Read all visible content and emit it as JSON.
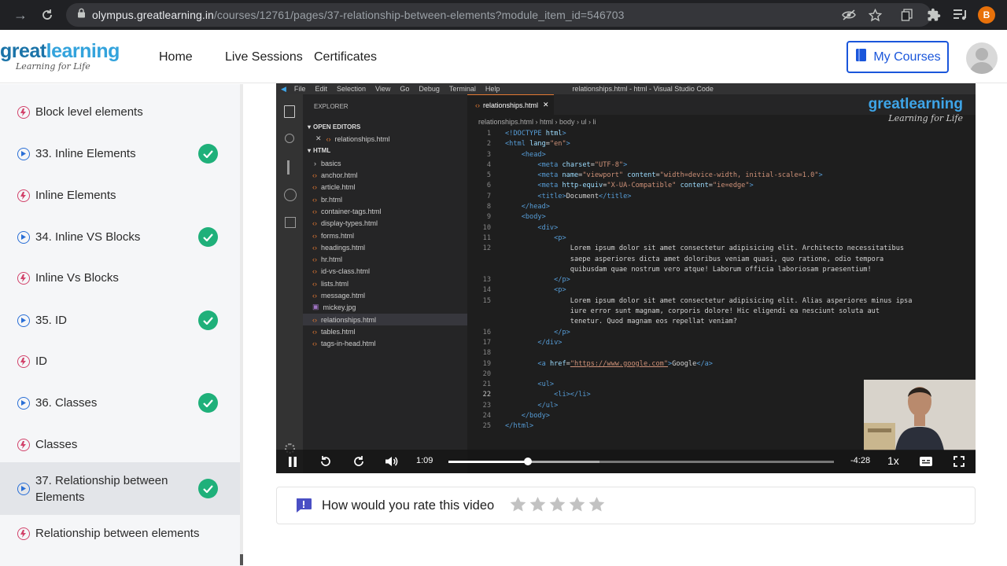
{
  "browser": {
    "url_host": "olympus.greatlearning.in",
    "url_path": "/courses/12761/pages/37-relationship-between-elements?module_item_id=546703",
    "profile_initial": "B"
  },
  "header": {
    "logo_main_a": "great",
    "logo_main_b": "learning",
    "logo_sub": "Learning for Life",
    "nav": [
      "Home",
      "Live Sessions",
      "Certificates"
    ],
    "my_courses": "My Courses"
  },
  "sidebar": {
    "items": [
      {
        "label": "Block level elements",
        "kind": "page",
        "done": false
      },
      {
        "label": "33. Inline Elements",
        "kind": "video",
        "done": true
      },
      {
        "label": "Inline Elements",
        "kind": "page",
        "done": false
      },
      {
        "label": "34. Inline VS Blocks",
        "kind": "video",
        "done": true
      },
      {
        "label": "Inline Vs Blocks",
        "kind": "page",
        "done": false
      },
      {
        "label": "35. ID",
        "kind": "video",
        "done": true
      },
      {
        "label": "ID",
        "kind": "page",
        "done": false
      },
      {
        "label": "36. Classes",
        "kind": "video",
        "done": true
      },
      {
        "label": "Classes",
        "kind": "page",
        "done": false
      },
      {
        "label": "37. Relationship between",
        "label2": "Elements",
        "kind": "video",
        "done": true
      },
      {
        "label": "Relationship between elements",
        "kind": "page",
        "done": false
      }
    ]
  },
  "video": {
    "vscode": {
      "menu": [
        "File",
        "Edit",
        "Selection",
        "View",
        "Go",
        "Debug",
        "Terminal",
        "Help"
      ],
      "window_title": "relationships.html - html - Visual Studio Code",
      "explorer_title": "EXPLORER",
      "open_editors": "OPEN EDITORS",
      "open_file": "relationships.html",
      "folder": "HTML",
      "files": [
        "basics",
        "anchor.html",
        "article.html",
        "br.html",
        "container-tags.html",
        "display-types.html",
        "forms.html",
        "headings.html",
        "hr.html",
        "id-vs-class.html",
        "lists.html",
        "message.html",
        "mickey.jpg",
        "relationships.html",
        "tables.html",
        "tags-in-head.html"
      ],
      "tab": "relationships.html",
      "breadcrumb": "relationships.html › html › body › ul › li",
      "logo_a": "greatlearning",
      "logo_b": "Learning for Life"
    },
    "current_time": "1:09",
    "remaining_time": "-4:28",
    "speed": "1x",
    "progress_fraction": 0.206
  },
  "rating": {
    "prompt": "How would you rate this video",
    "stars": 5
  }
}
